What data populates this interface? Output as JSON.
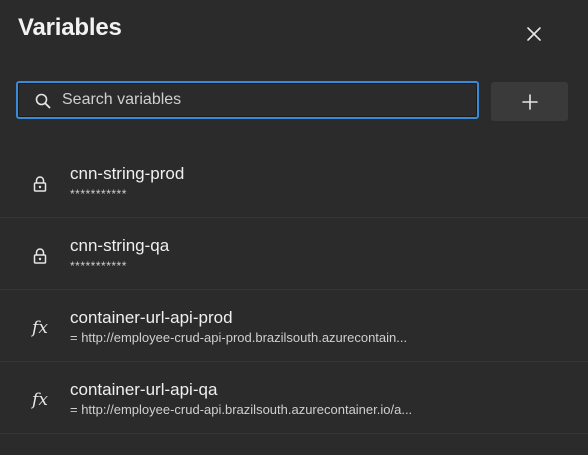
{
  "panel": {
    "title": "Variables"
  },
  "search": {
    "placeholder": "Search variables",
    "value": ""
  },
  "icons": {
    "close": "close-icon",
    "search": "search-icon",
    "add": "plus-icon",
    "secret": "lock-icon",
    "expression": "fx-icon"
  },
  "colors": {
    "background": "#2b2b2b",
    "focus_border": "#3b8ad8",
    "button_bg": "#3a3a3a",
    "divider": "#363636"
  },
  "variables": [
    {
      "name": "cnn-string-prod",
      "value": "***********",
      "type": "secret"
    },
    {
      "name": "cnn-string-qa",
      "value": "***********",
      "type": "secret"
    },
    {
      "name": "container-url-api-prod",
      "value": "= http://employee-crud-api-prod.brazilsouth.azurecontain...",
      "type": "expression"
    },
    {
      "name": "container-url-api-qa",
      "value": "= http://employee-crud-api.brazilsouth.azurecontainer.io/a...",
      "type": "expression"
    }
  ]
}
